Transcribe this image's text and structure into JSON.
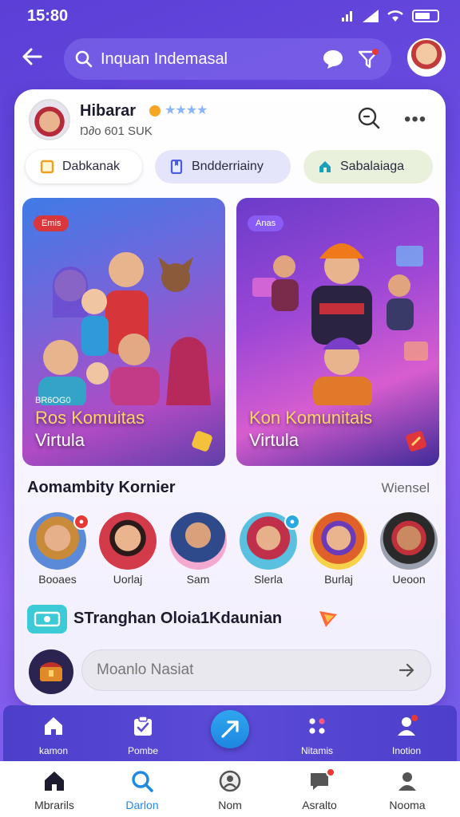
{
  "status": {
    "time": "15:80"
  },
  "search": {
    "query": "Inquan Indemasal"
  },
  "profile": {
    "name": "Hibarar",
    "stars": "★★★★",
    "subtitle": "Ŋ∂o 601 SUK"
  },
  "chips": [
    {
      "label": "Dabkanak",
      "icon": "square-icon"
    },
    {
      "label": "Bndderriainy",
      "icon": "bookmark-icon"
    },
    {
      "label": "Sabalaiaga",
      "icon": "house-icon"
    }
  ],
  "features": [
    {
      "badge": "Emis",
      "small": "BR6OG0",
      "title_line1": "Ros Komuitas",
      "title_line2": "Virtula"
    },
    {
      "badge": "Anas",
      "small": "",
      "title_line1": "Kon Komunitais",
      "title_line2": "Virtula"
    }
  ],
  "section": {
    "title": "Aomambity Kornier",
    "link": "Wiensel"
  },
  "members": [
    {
      "name": "Booaes",
      "badge": "●"
    },
    {
      "name": "Uorlaj",
      "badge": ""
    },
    {
      "name": "Sam",
      "badge": ""
    },
    {
      "name": "Slerla",
      "badge": "●"
    },
    {
      "name": "Burlaj",
      "badge": ""
    },
    {
      "name": "Ueoon",
      "badge": ""
    }
  ],
  "promo": {
    "text": "STranghan Oloia1Kdaunian"
  },
  "composer": {
    "placeholder": "Moanlo Nasiat"
  },
  "action_bar": [
    {
      "label": "kamon",
      "icon": "home-icon"
    },
    {
      "label": "Pombe",
      "icon": "clipboard-check-icon"
    },
    {
      "label": "",
      "icon": "send-fab-icon"
    },
    {
      "label": "Nitamis",
      "icon": "dots-grid-icon"
    },
    {
      "label": "Inotion",
      "icon": "user-icon"
    }
  ],
  "tabs": [
    {
      "label": "Mbrarils",
      "icon": "home-icon",
      "active": false
    },
    {
      "label": "Darlon",
      "icon": "search-icon",
      "active": true
    },
    {
      "label": "Nom",
      "icon": "profile-circle-icon",
      "active": false
    },
    {
      "label": "Asralto",
      "icon": "chat-icon",
      "active": false
    },
    {
      "label": "Nooma",
      "icon": "user-icon",
      "active": false
    }
  ],
  "colors": {
    "accent": "#1e88e5",
    "background": "#6a4be0",
    "badge_red": "#e53935",
    "promo_teal": "#3ccad6"
  }
}
